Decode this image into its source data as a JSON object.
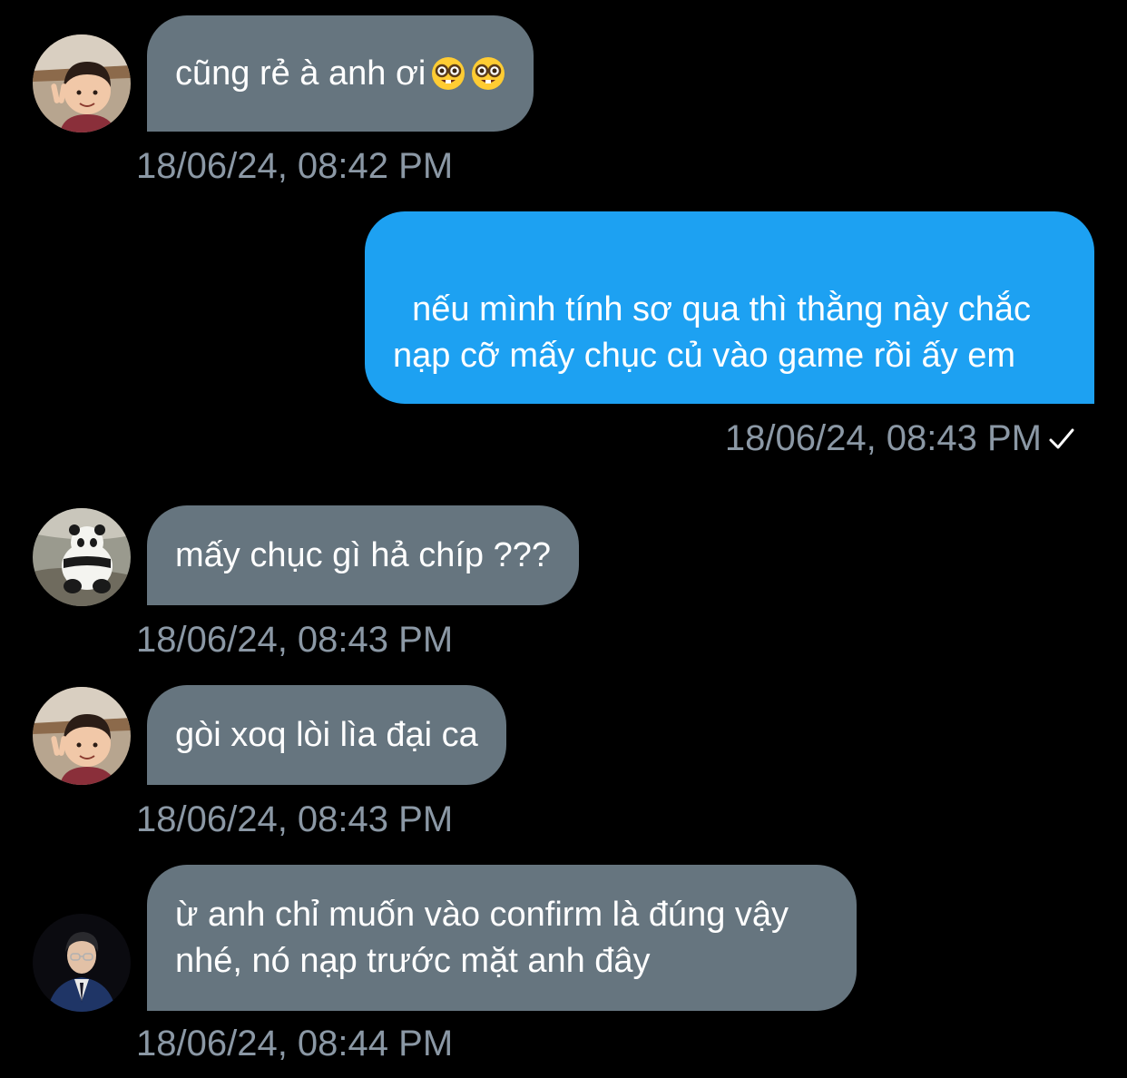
{
  "messages": [
    {
      "direction": "incoming",
      "avatar": "boy-peace-sign-avatar",
      "text": "cũng rẻ à anh ơi",
      "emoji": [
        "nerd-face-emoji",
        "nerd-face-emoji"
      ],
      "timestamp": "18/06/24, 08:42 PM"
    },
    {
      "direction": "outgoing",
      "text": "nếu mình tính sơ qua thì thằng này chắc nạp cỡ mấy chục củ vào game rồi ấy em",
      "timestamp": "18/06/24, 08:43 PM",
      "status": "sent-check-icon"
    },
    {
      "direction": "incoming",
      "avatar": "panda-avatar",
      "text": "mấy chục gì hả chíp ???",
      "timestamp": "18/06/24, 08:43 PM"
    },
    {
      "direction": "incoming",
      "avatar": "boy-peace-sign-avatar",
      "text": "gòi xoq lòi lìa đại ca",
      "timestamp": "18/06/24, 08:43 PM"
    },
    {
      "direction": "incoming",
      "avatar": "man-in-suit-avatar",
      "text": "ừ anh chỉ muốn vào confirm là đúng vậy nhé, nó nạp trước mặt anh đây",
      "timestamp": "18/06/24, 08:44 PM"
    }
  ],
  "colors": {
    "background": "#000000",
    "incoming_bubble": "#66757f",
    "outgoing_bubble": "#1da1f2",
    "timestamp_text": "#8b98a5",
    "bubble_text": "#ffffff"
  }
}
